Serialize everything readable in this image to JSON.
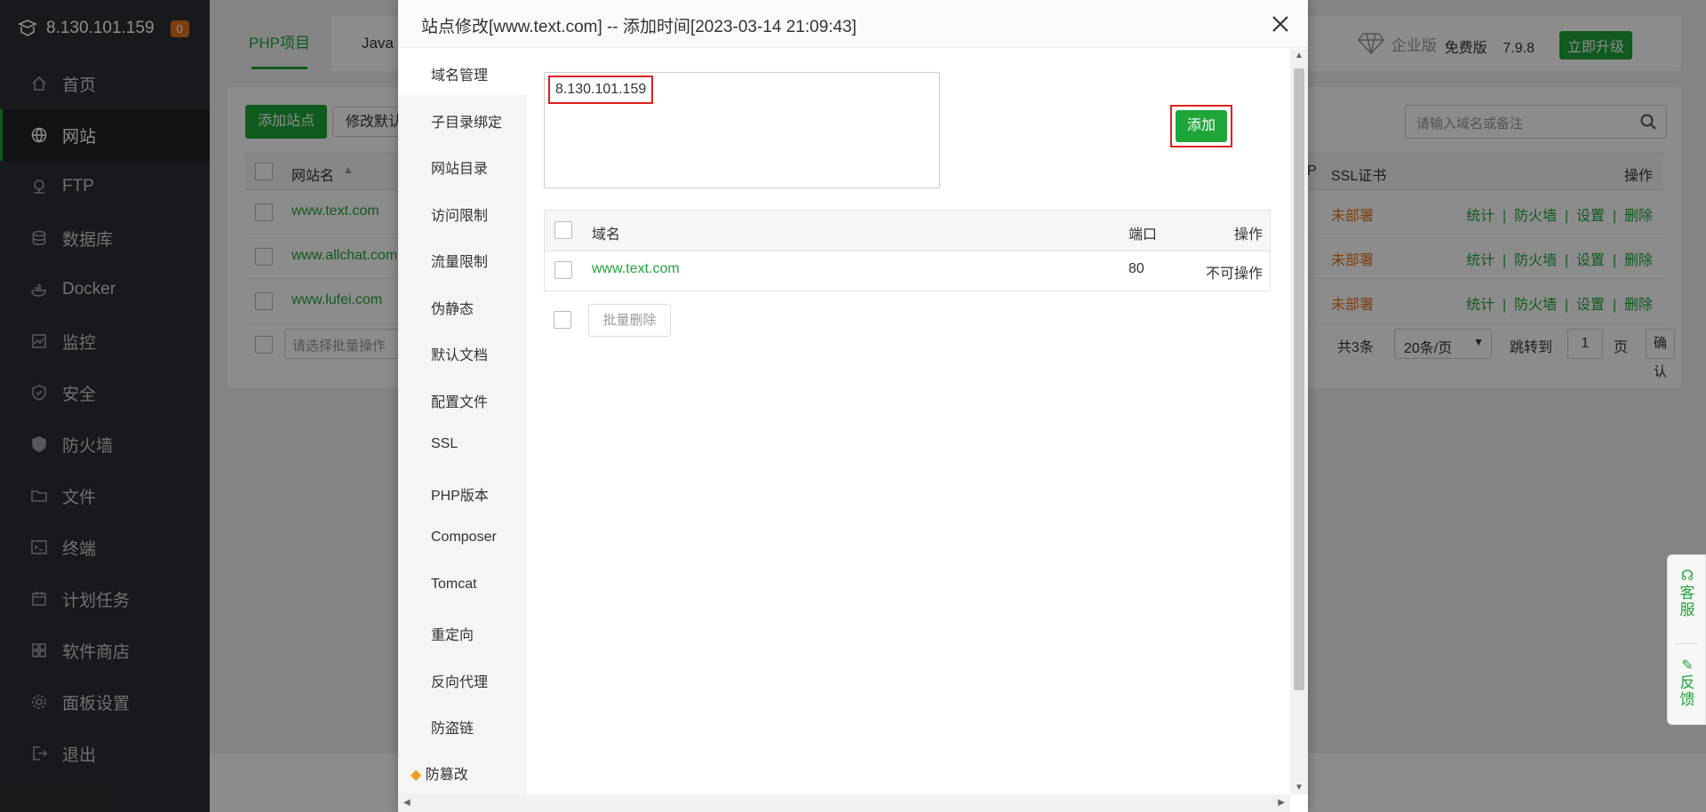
{
  "sidebar": {
    "server_ip": "8.130.101.159",
    "badge": "0",
    "items": [
      {
        "label": "首页",
        "icon": "home-icon"
      },
      {
        "label": "网站",
        "icon": "globe-icon"
      },
      {
        "label": "FTP",
        "icon": "ftp-icon"
      },
      {
        "label": "数据库",
        "icon": "database-icon"
      },
      {
        "label": "Docker",
        "icon": "docker-icon"
      },
      {
        "label": "监控",
        "icon": "monitor-icon"
      },
      {
        "label": "安全",
        "icon": "shield-icon"
      },
      {
        "label": "防火墙",
        "icon": "firewall-icon"
      },
      {
        "label": "文件",
        "icon": "folder-icon"
      },
      {
        "label": "终端",
        "icon": "terminal-icon"
      },
      {
        "label": "计划任务",
        "icon": "calendar-icon"
      },
      {
        "label": "软件商店",
        "icon": "grid-icon"
      },
      {
        "label": "面板设置",
        "icon": "gear-icon"
      },
      {
        "label": "退出",
        "icon": "logout-icon"
      }
    ],
    "active": "网站"
  },
  "header": {
    "tabs": [
      "PHP项目",
      "Java"
    ],
    "enterprise": "企业版",
    "free_version": "免费版",
    "version": "7.9.8",
    "upgrade": "立即升级"
  },
  "sites": {
    "add_site": "添加站点",
    "modify_default": "修改默认",
    "search_placeholder": "请输入域名或备注",
    "columns": {
      "name": "网站名",
      "ssl": "SSL证书",
      "ops": "操作",
      "partial": "P"
    },
    "rows": [
      {
        "name": "www.text.com",
        "ssl": "未部署"
      },
      {
        "name": "www.allchat.com",
        "ssl": "未部署"
      },
      {
        "name": "www.lufei.com",
        "ssl": "未部署"
      }
    ],
    "row_actions": [
      "统计",
      "防火墙",
      "设置",
      "删除"
    ],
    "batch_placeholder": "请选择批量操作",
    "total": "共3条",
    "per_page": "20条/页",
    "jump_to": "跳转到",
    "page": "1",
    "page_unit": "页",
    "confirm": "确认"
  },
  "float_help": {
    "service": "客服",
    "feedback": "反馈"
  },
  "modal": {
    "title": "站点修改[www.text.com] -- 添加时间[2023-03-14 21:09:43]",
    "nav": [
      "域名管理",
      "子目录绑定",
      "网站目录",
      "访问限制",
      "流量限制",
      "伪静态",
      "默认文档",
      "配置文件",
      "SSL",
      "PHP版本",
      "Composer",
      "Tomcat",
      "重定向",
      "反向代理",
      "防盗链",
      "防篡改"
    ],
    "selected_nav": "域名管理",
    "domain_input_value": "8.130.101.159",
    "add_button": "添加",
    "table": {
      "col_domain": "域名",
      "col_port": "端口",
      "col_ops": "操作",
      "rows": [
        {
          "domain": "www.text.com",
          "port": "80",
          "op": "不可操作"
        }
      ]
    },
    "batch_delete": "批量删除"
  },
  "colors": {
    "accent": "#20a53a",
    "warning": "#e0731d",
    "highlight": "#e02020"
  }
}
